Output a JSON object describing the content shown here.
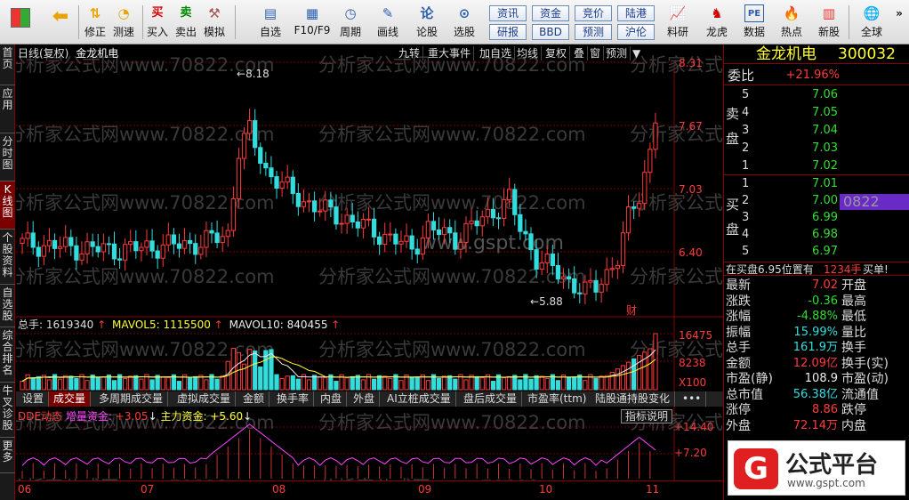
{
  "toolbar": {
    "buttons": [
      {
        "label": "",
        "icon": "grid-icon"
      },
      {
        "label": "",
        "icon": "back-arrow-icon"
      },
      {
        "label": "修正",
        "icon": "up-down-icon"
      },
      {
        "label": "测速",
        "icon": "clock-icon"
      },
      {
        "label": "买入",
        "icon": "buy-icon"
      },
      {
        "label": "卖出",
        "icon": "sell-icon"
      },
      {
        "label": "模拟",
        "icon": "hammer-icon"
      },
      {
        "label": "自选",
        "icon": "folder-icon"
      },
      {
        "label": "F10/F9",
        "icon": "f10-icon"
      },
      {
        "label": "周期",
        "icon": "period-icon"
      },
      {
        "label": "画线",
        "icon": "pen-icon"
      },
      {
        "label": "论股",
        "icon": "discuss-icon"
      },
      {
        "label": "选股",
        "icon": "select-stock-icon"
      },
      {
        "label": "料研",
        "icon": "chart-icon"
      },
      {
        "label": "龙虎",
        "icon": "dragon-icon"
      },
      {
        "label": "数据",
        "icon": "pe-icon"
      },
      {
        "label": "热点",
        "icon": "hot-icon"
      },
      {
        "label": "新股",
        "icon": "ipo-icon"
      },
      {
        "label": "全球",
        "icon": "globe-icon"
      }
    ],
    "square_buttons": [
      "资讯",
      "资金",
      "竞价",
      "陆港",
      "研报",
      "BBD",
      "预测",
      "沪伦"
    ]
  },
  "leftbar": {
    "tabs": [
      "首页",
      "应用",
      "分时图",
      "K线图",
      "个股资料",
      "自选股",
      "综合排名",
      "牛叉诊股",
      "更多"
    ]
  },
  "chart_header": {
    "period": "日线(复权)",
    "stock_name": "金龙机电",
    "buttons": [
      "九转",
      "重大事件",
      "加自选",
      "均线",
      "复权",
      "叠",
      "窗",
      "预测"
    ]
  },
  "price_axis": {
    "labels": [
      "8.31",
      "7.67",
      "7.03",
      "6.40"
    ],
    "high_mark": "8.18",
    "low_mark": "5.88",
    "event_mark": "财"
  },
  "volume_header": {
    "total": "总手: 1619340",
    "mavol5": "MAVOL5: 1115500",
    "mavol10": "MAVOL10: 840455",
    "axis_labels": [
      "16475",
      "8238",
      "X100"
    ]
  },
  "indicator_tabs": [
    "设置",
    "成交量",
    "多周期成交量",
    "虚拟成交量",
    "金额",
    "换手率",
    "内盘",
    "外盘",
    "AI立桩成交量",
    "盘后成交量",
    "市盈率(ttm)",
    "陆股通持股变化",
    "•••"
  ],
  "dde": {
    "title": "DDE动态",
    "inc_label": "增量资金:",
    "inc_val": "+3.05",
    "main_label": "主力资金:",
    "main_val": "+5.60",
    "help": "指标说明",
    "axis_labels": [
      "+14.40",
      "+7.20"
    ]
  },
  "date_axis": [
    "06",
    "07",
    "08",
    "09",
    "10",
    "11"
  ],
  "watermark": [
    "分析家公式网www.70822.com",
    "www.gspt.com"
  ],
  "quote": {
    "name": "金龙机电",
    "code": "300032",
    "weibi_label": "委比",
    "weibi": "+21.96%",
    "sell_label": "卖盘",
    "buy_label": "买盘",
    "sell": [
      {
        "lvl": "5",
        "price": "7.06"
      },
      {
        "lvl": "4",
        "price": "7.05"
      },
      {
        "lvl": "3",
        "price": "7.04"
      },
      {
        "lvl": "2",
        "price": "7.03"
      },
      {
        "lvl": "1",
        "price": "7.02"
      }
    ],
    "buy": [
      {
        "lvl": "1",
        "price": "7.01"
      },
      {
        "lvl": "2",
        "price": "7.00"
      },
      {
        "lvl": "3",
        "price": "6.99"
      },
      {
        "lvl": "4",
        "price": "6.98"
      },
      {
        "lvl": "5",
        "price": "6.97"
      }
    ],
    "highlight_code": "0822",
    "notice": "在买盘6.95位置有",
    "notice_qty": "1234手",
    "notice_act": "买单!",
    "stats": [
      {
        "l": "最新",
        "v": "7.02",
        "r": "开盘"
      },
      {
        "l": "涨跌",
        "v": "-0.36",
        "r": "最高"
      },
      {
        "l": "涨幅",
        "v": "-4.88%",
        "r": "最低"
      },
      {
        "l": "振幅",
        "v": "15.99%",
        "r": "量比"
      },
      {
        "l": "总手",
        "v": "161.9万",
        "r": "换手"
      },
      {
        "l": "金额",
        "v": "12.09亿",
        "r": "换手(实)"
      },
      {
        "l": "市盈(静)",
        "v": "108.9",
        "r": "市盈(动)"
      },
      {
        "l": "总市值",
        "v": "56.38亿",
        "r": "流通值"
      },
      {
        "l": "涨停",
        "v": "8.86",
        "r": "跌停"
      },
      {
        "l": "外盘",
        "v": "72.14万",
        "r": "内盘"
      }
    ]
  },
  "logo": {
    "text": "公式平台",
    "url": "www.gspt.com"
  },
  "colors": {
    "up": "#ff3b3b",
    "down": "#33dddd",
    "bg": "#000000",
    "grid": "#8b0000"
  }
}
